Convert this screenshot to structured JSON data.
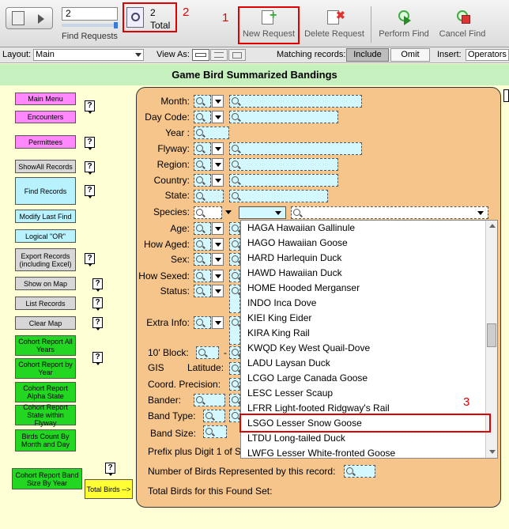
{
  "toolbar": {
    "find_value": "2",
    "find_requests_label": "Find Requests",
    "total_count": "2",
    "total_label": "Total",
    "new_request": "New Request",
    "delete_request": "Delete Request",
    "perform_find": "Perform Find",
    "cancel_find": "Cancel Find"
  },
  "layoutbar": {
    "layout_label": "Layout:",
    "layout_value": "Main",
    "view_as_label": "View As:",
    "matching_label": "Matching records:",
    "include": "Include",
    "omit": "Omit",
    "insert_label": "Insert:",
    "insert_value": "Operators"
  },
  "page_title": "Game Bird Summarized Bandings",
  "nav": {
    "main_menu": "Main Menu",
    "encounters": "Encounters",
    "permittees": "Permittees",
    "show_all": "ShowAll Records",
    "find_records": "Find Records",
    "modify_last_find": "Modify Last Find",
    "logical_or": "Logical \"OR\"",
    "export_records": "Export Records (including Excel)",
    "show_on_map": "Show on Map",
    "list_records": "List Records",
    "clear_map": "Clear Map",
    "cohort_all_years": "Cohort Report All Years",
    "cohort_by_year": "Cohort Report by Year",
    "cohort_alpha_state": "Cohort Report Alpha State",
    "cohort_state_flyway": "Cohort Report State within Flyway",
    "birds_count": "Birds Count By Month and Day",
    "cohort_band_size": "Cohort Report Band Size By Year",
    "total_birds": "Total Birds -->",
    "help_glyph": "?"
  },
  "form": {
    "month": "Month:",
    "day_code": "Day Code:",
    "year": "Year :",
    "flyway": "Flyway:",
    "region": "Region:",
    "country": "Country:",
    "state": "State:",
    "species": "Species:",
    "age": "Age:",
    "how_aged": "How Aged:",
    "sex": "Sex:",
    "how_sexed": "How Sexed:",
    "status": "Status:",
    "extra_info": "Extra Info:",
    "ten_block": "10' Block:",
    "dash": "-",
    "gis": "GIS",
    "latitude": "Latitude:",
    "coord_precision": "Coord. Precision:",
    "bander": "Bander:",
    "band_type": "Band Type:",
    "band_size": "Band Size:",
    "prefix_text": "Prefix plus Digit 1 of S",
    "num_birds": "Number of Birds Represented by this record:",
    "total_found": "Total Birds for this Found Set:"
  },
  "species_list": [
    "HAGA Hawaiian Gallinule",
    "HAGO Hawaiian Goose",
    "HARD Harlequin Duck",
    "HAWD Hawaiian Duck",
    "HOME Hooded Merganser",
    "INDO Inca Dove",
    "KIEI King Eider",
    "KIRA King Rail",
    "KWQD Key West Quail-Dove",
    "LADU Laysan Duck",
    "LCGO Large Canada Goose",
    "LESC Lesser Scaup",
    "LFRR Light-footed Ridgway's Rail",
    "LSGO Lesser Snow Goose",
    "LTDU Long-tailed Duck",
    "LWFG Lesser White-fronted Goose"
  ],
  "annotations": {
    "one": "1",
    "two": "2",
    "three": "3"
  },
  "colors": {
    "highlight_red": "#e00000",
    "panel": "#f5c58c",
    "field": "#d4f8ff",
    "title_band": "#c7f0bf"
  }
}
